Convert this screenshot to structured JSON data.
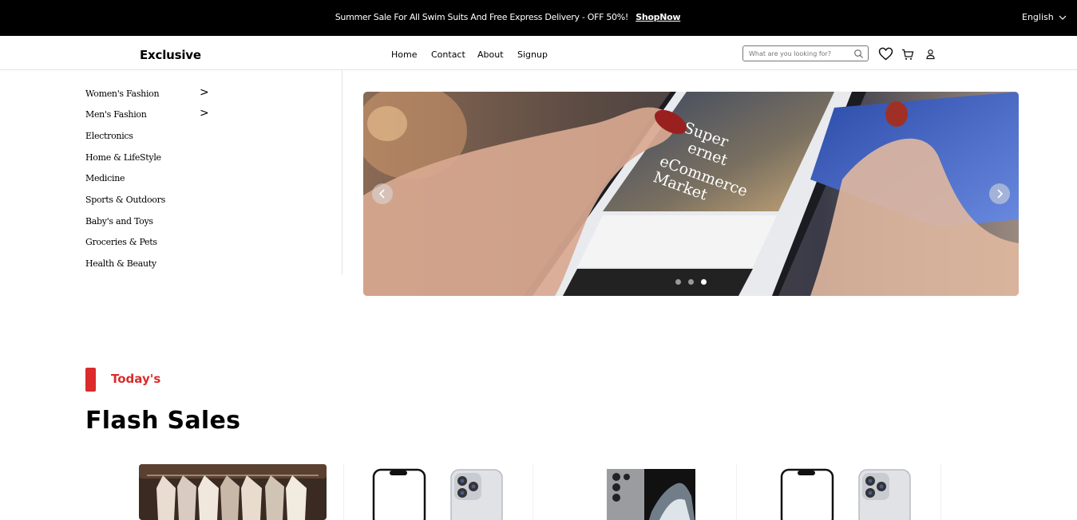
{
  "topbar": {
    "promo_text": "Summer Sale For All Swim Suits And Free Express Delivery - OFF 50%!",
    "promo_link": "ShopNow",
    "language": "English"
  },
  "nav": {
    "logo": "Exclusive",
    "links": [
      "Home",
      "Contact",
      "About",
      "Signup"
    ],
    "search_placeholder": "What are you looking for?"
  },
  "categories": [
    {
      "label": "Women's Fashion",
      "arrow": ">"
    },
    {
      "label": "Men's Fashion",
      "arrow": ">"
    },
    {
      "label": "Electronics"
    },
    {
      "label": "Home & LifeStyle"
    },
    {
      "label": "Medicine"
    },
    {
      "label": "Sports & Outdoors"
    },
    {
      "label": "Baby's and Toys"
    },
    {
      "label": "Groceries & Pets"
    },
    {
      "label": "Health & Beauty"
    }
  ],
  "banner": {
    "screen_text": [
      "Super",
      "ernet",
      "eCommerce",
      "Market"
    ],
    "slide_count": 3,
    "active_slide": 3
  },
  "flash": {
    "label": "Today's",
    "title": "Flash Sales"
  },
  "products": [
    {
      "image": "clothes-rack"
    },
    {
      "image": "iphone"
    },
    {
      "image": "galaxy-phone"
    },
    {
      "image": "iphone"
    }
  ],
  "colors": {
    "accent": "#db2b2b",
    "topbar": "#000000"
  }
}
